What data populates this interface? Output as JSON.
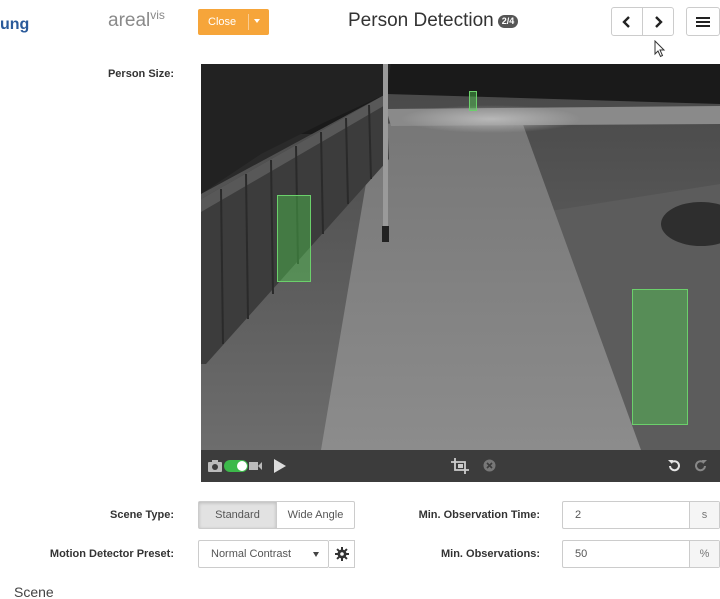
{
  "header": {
    "cut_title": "ung",
    "brand_main": "areal",
    "brand_sup": "vis",
    "close_label": "Close",
    "title": "Person Detection",
    "badge": "2/4",
    "accent_color": "#f6a53a"
  },
  "form": {
    "person_size_label": "Person Size:",
    "scene_type_label": "Scene Type:",
    "scene_type_options": [
      "Standard",
      "Wide Angle"
    ],
    "scene_type_selected": "Standard",
    "motion_preset_label": "Motion Detector Preset:",
    "motion_preset_value": "Normal Contrast",
    "min_obs_time_label": "Min. Observation Time:",
    "min_obs_time_value": "2",
    "min_obs_time_unit": "s",
    "min_obs_label": "Min. Observations:",
    "min_obs_value": "50",
    "min_obs_unit": "%"
  },
  "video_toolbar": {
    "icons": [
      "camera-icon",
      "mode-toggle",
      "video-camera-icon",
      "play-icon",
      "crop-icon",
      "clear-icon",
      "undo-icon",
      "redo-icon"
    ]
  },
  "detections": {
    "color": "#50d250",
    "count": 3
  },
  "section": {
    "title": "Scene"
  }
}
